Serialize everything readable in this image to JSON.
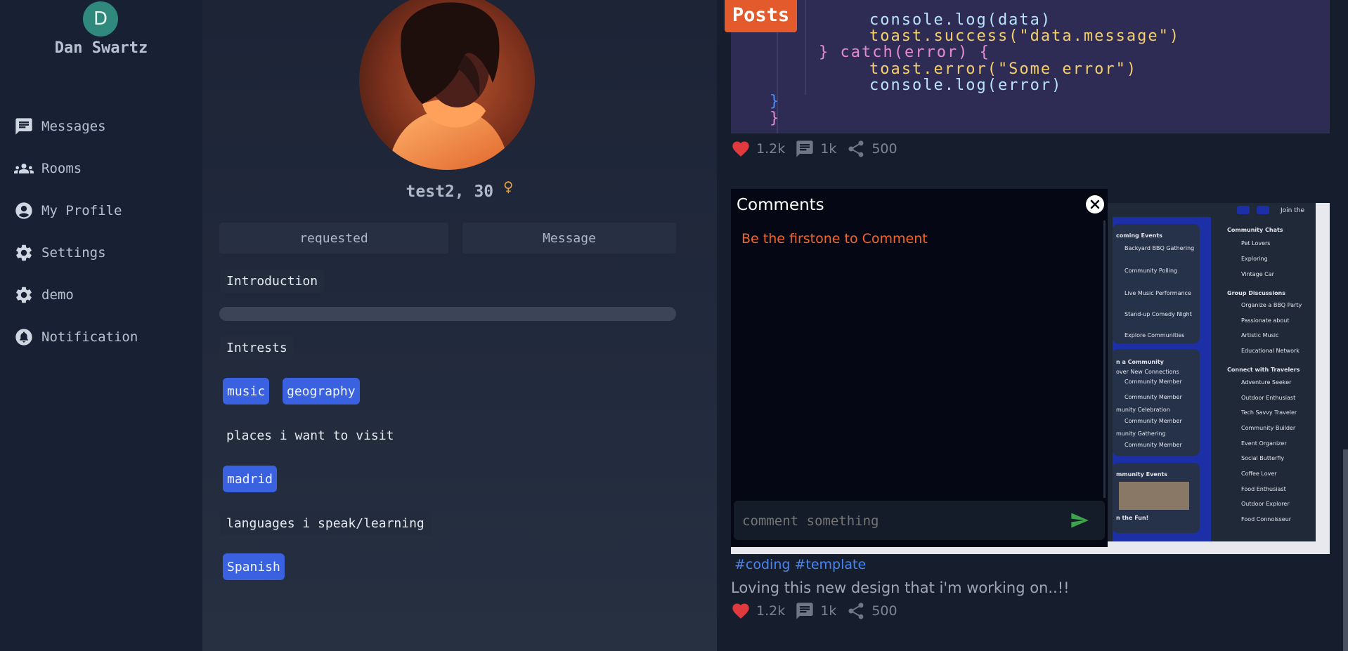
{
  "sidebar": {
    "avatar_letter": "D",
    "user_name": "Dan Swartz",
    "items": [
      {
        "label": "Messages",
        "icon": "chat-icon"
      },
      {
        "label": "Rooms",
        "icon": "group-icon"
      },
      {
        "label": "My Profile",
        "icon": "account-circle-icon"
      },
      {
        "label": "Settings",
        "icon": "gear-icon"
      },
      {
        "label": "demo",
        "icon": "gear-icon"
      },
      {
        "label": "Notification",
        "icon": "bell-icon"
      }
    ]
  },
  "profile": {
    "name_age": "test2, 30",
    "gender_symbol": "♀",
    "request_button": "requested",
    "message_button": "Message",
    "introduction_label": "Introduction",
    "interests_label": "Intrests",
    "interests": [
      "music",
      "geography"
    ],
    "places_label": "places i want to visit",
    "places": [
      "madrid"
    ],
    "languages_label": "languages i speak/learning",
    "languages": [
      "Spanish"
    ]
  },
  "posts": {
    "badge": "Posts",
    "code_lines": [
      "console.log(data)",
      "toast.success(\"data.message\")",
      "} catch(error) {",
      "toast.error(\"Some error\")",
      "console.log(error)",
      "}",
      "}"
    ],
    "post1_stats": {
      "likes": "1.2k",
      "comments": "1k",
      "shares": "500"
    },
    "post2": {
      "hashtags": [
        "#coding",
        "#template"
      ],
      "caption": "Loving this new design that i'm working on..!!",
      "stats": {
        "likes": "1.2k",
        "comments": "1k",
        "shares": "500"
      }
    },
    "mock_image": {
      "join": "Join the",
      "left_col": [
        "coming Events",
        "Backyard BBQ Gathering",
        "Community Polling",
        "Live Music Performance",
        "Stand-up Comedy Night",
        "Explore Communities",
        "n a Community",
        "over New Connections",
        "Community Member",
        "Community Member",
        "munity Celebration",
        "Community Member",
        "munity Gathering",
        "Community Member",
        "mmunity Events",
        "n the Fun!"
      ],
      "right_col": [
        "Community Chats",
        "Pet Lovers",
        "Exploring",
        "Vintage Car",
        "Group Discussions",
        "Organize a BBQ Party",
        "Passionate about",
        "Artistic Music",
        "Educational Network",
        "Connect with Travelers",
        "Adventure Seeker",
        "Outdoor Enthusiast",
        "Tech Savvy Traveler",
        "Community Builder",
        "Event Organizer",
        "Social Butterfly",
        "Coffee Lover",
        "Food Enthusiast",
        "Outdoor Explorer",
        "Food Connoisseur"
      ]
    }
  },
  "comments": {
    "title": "Comments",
    "empty_message": "Be the firstone to Comment",
    "input_placeholder": "comment something"
  },
  "colors": {
    "accent_orange": "#e35b2c",
    "tag_blue": "#3a62e0",
    "heart_red": "#e0393e",
    "send_green": "#3fa34d"
  }
}
